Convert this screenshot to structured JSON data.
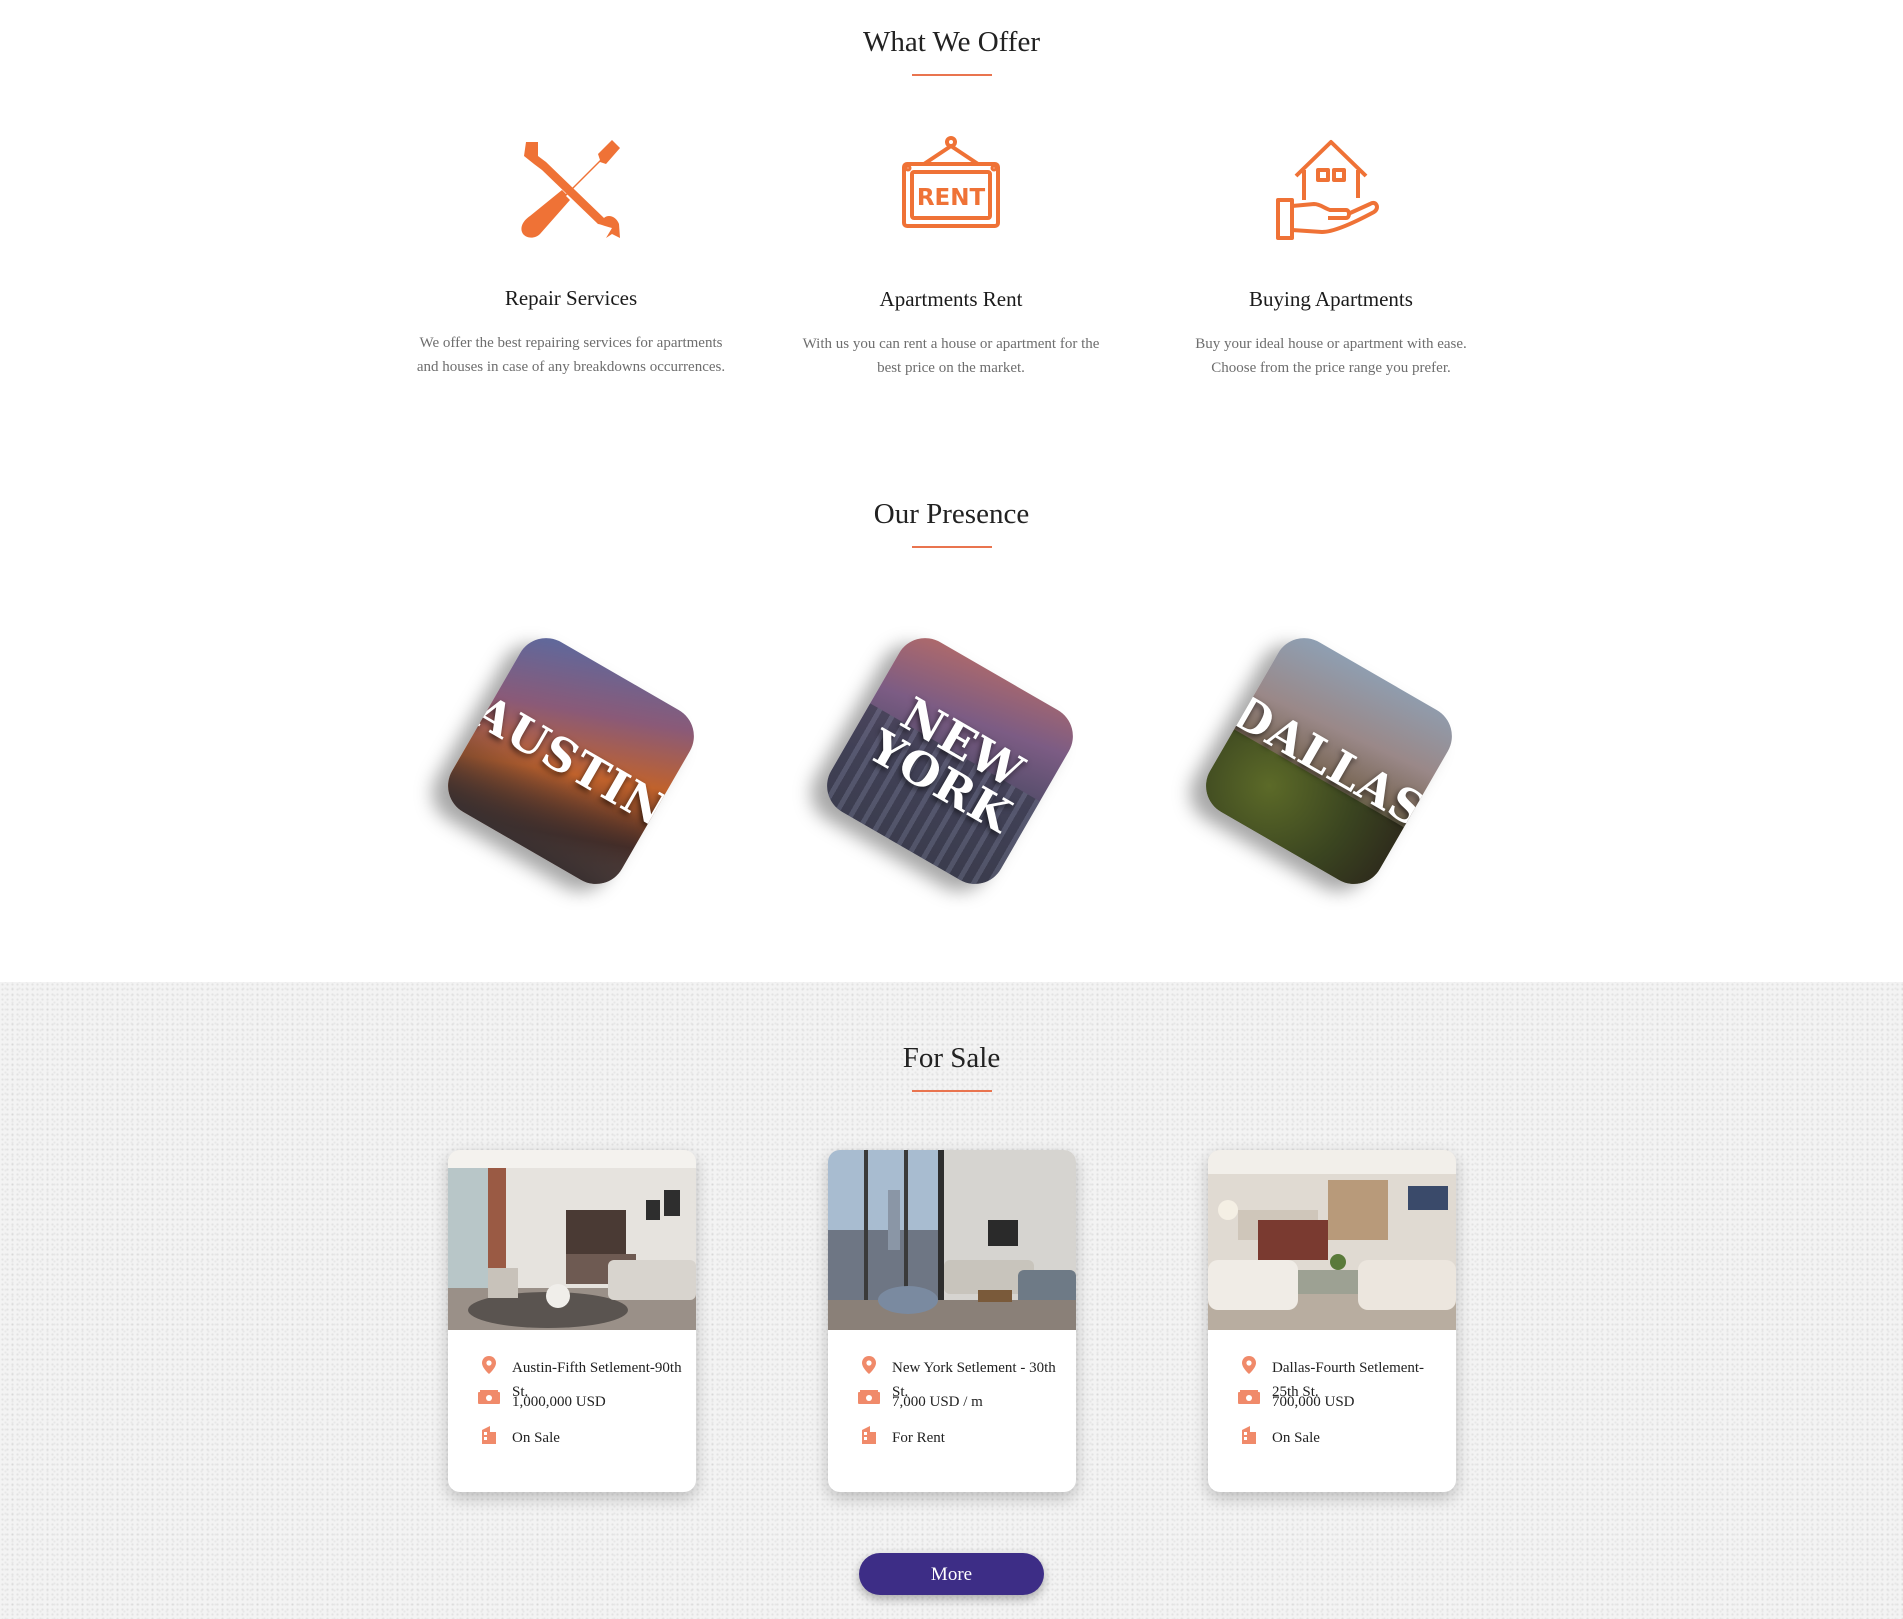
{
  "offer": {
    "title": "What We Offer",
    "items": [
      {
        "heading": "Repair Services",
        "text": "We offer the best repairing services for apartments and houses in case of any breakdowns occurrences.",
        "icon": "wrench-screwdriver-icon"
      },
      {
        "heading": "Apartments Rent",
        "text": "With us you can rent a house or apartment for the best price on the market.",
        "icon": "rent-sign-icon",
        "sign_text": "RENT"
      },
      {
        "heading": "Buying Apartments",
        "text": "Buy your ideal house or apartment with ease. Choose from the price range you prefer.",
        "icon": "house-in-hand-icon"
      }
    ]
  },
  "presence": {
    "title": "Our Presence",
    "cities": [
      {
        "name": "AUSTIN"
      },
      {
        "name": "NEW YORK"
      },
      {
        "name": "DALLAS"
      }
    ]
  },
  "sale": {
    "title": "For Sale",
    "cards": [
      {
        "address": "Austin-Fifth Setlement-90th St.",
        "price": "1,000,000 USD",
        "status": "On Sale"
      },
      {
        "address": "New York Setlement - 30th St.",
        "price": "7,000 USD / m",
        "status": "For Rent"
      },
      {
        "address": "Dallas-Fourth Setlement-25th St.",
        "price": "700,000 USD",
        "status": "On Sale"
      }
    ],
    "more_label": "More"
  },
  "colors": {
    "accent": "#e9744f",
    "button": "#3d2d86"
  }
}
